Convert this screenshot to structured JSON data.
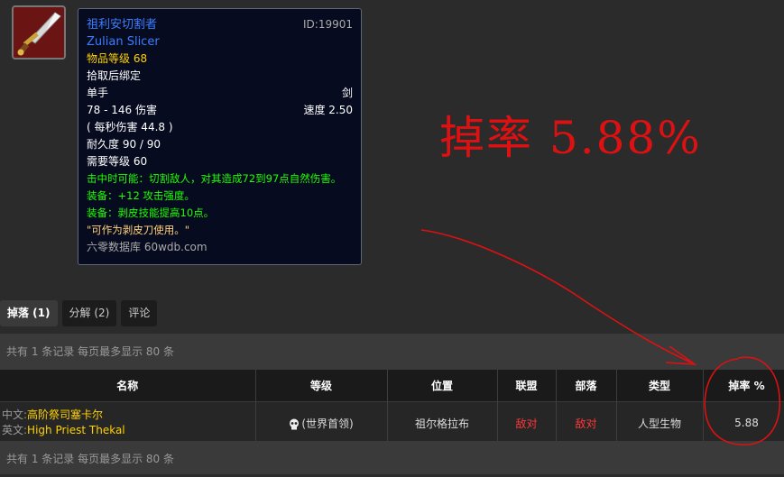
{
  "item": {
    "icon": "sword-icon",
    "name_cn": "祖利安切割者",
    "id_label": "ID:19901",
    "name_en": "Zulian Slicer",
    "item_level": "物品等级 68",
    "bind": "拾取后绑定",
    "slot": "单手",
    "weapon_type": "剑",
    "damage": "78 - 146 伤害",
    "speed": "速度 2.50",
    "dps": "( 每秒伤害 44.8 )",
    "durability": "耐久度 90 / 90",
    "req_level": "需要等级 60",
    "effect_chance": "击中时可能：切割敌人，对其造成72到97点自然伤害。",
    "effect_equip1": "装备：+12 攻击强度。",
    "effect_equip2": "装备：剥皮技能提高10点。",
    "flavor": "\"可作为剥皮刀使用。\"",
    "source": "六零数据库 60wdb.com"
  },
  "annotation": {
    "text": "掉率 5.88%",
    "color": "#dd1111"
  },
  "tabs": [
    {
      "label": "掉落 (1)",
      "active": true
    },
    {
      "label": "分解 (2)",
      "active": false
    },
    {
      "label": "评论",
      "active": false
    }
  ],
  "records_text_top": "共有 1 条记录 每页最多显示 80 条",
  "records_text_bottom": "共有 1 条记录 每页最多显示 80 条",
  "table": {
    "headers": [
      "名称",
      "等级",
      "位置",
      "联盟",
      "部落",
      "类型",
      "掉率 %"
    ],
    "rows": [
      {
        "lang_cn": "中文:",
        "name_cn": "高阶祭司塞卡尔",
        "lang_en": "英文:",
        "name_en": "High Priest Thekal",
        "level": "(世界首领)",
        "location": "祖尔格拉布",
        "alliance": "敌对",
        "horde": "敌对",
        "type": "人型生物",
        "drop_rate": "5.88"
      }
    ]
  }
}
